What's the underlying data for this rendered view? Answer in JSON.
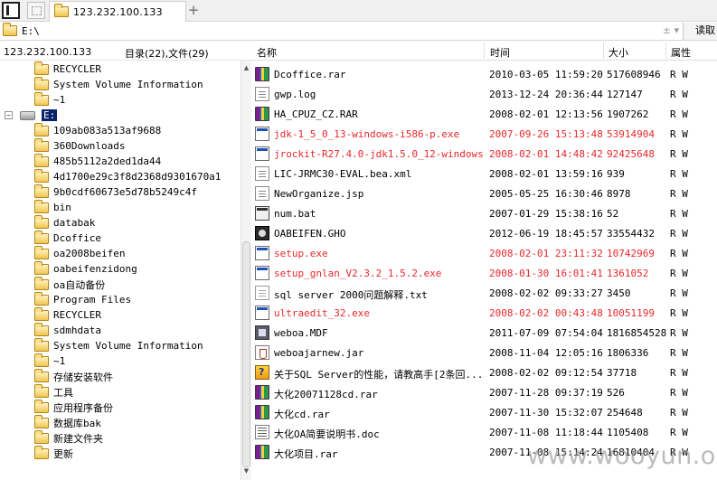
{
  "tab": {
    "title": "123.232.100.133",
    "add_label": "+"
  },
  "address": {
    "path": "E:\\",
    "controls": "± ▾",
    "go_label": "读取"
  },
  "left_panel": {
    "host": "123.232.100.133",
    "count": "目录(22),文件(29)"
  },
  "tree": {
    "items_before": [
      "RECYCLER",
      "System Volume Information",
      "~1"
    ],
    "drive": {
      "label": "E:",
      "expander": "−"
    },
    "items": [
      "109ab083a513af9688",
      "360Downloads",
      "485b5112a2ded1da44",
      "4d1700e29c3f8d2368d9301670a1",
      "9b0cdf60673e5d78b5249c4f",
      "bin",
      "databak",
      "Dcoffice",
      "oa2008beifen",
      "oabeifenzidong",
      "oa自动备份",
      "Program Files",
      "RECYCLER",
      "sdmhdata",
      "System Volume Information",
      "~1",
      "存储安装软件",
      "工具",
      "应用程序备份",
      "数据库bak",
      "新建文件夹",
      "更新"
    ]
  },
  "columns": {
    "name": "名称",
    "time": "时间",
    "size": "大小",
    "attr": "属性"
  },
  "files": [
    {
      "name": "Dcoffice.rar",
      "time": "2010-03-05 11:59:20",
      "size": "517608946",
      "attr": "R W",
      "icon": "rar-icon",
      "red": false
    },
    {
      "name": "gwp.log",
      "time": "2013-12-24 20:36:44",
      "size": "127147",
      "attr": "R W",
      "icon": "document-icon",
      "red": false
    },
    {
      "name": "HA_CPUZ_CZ.RAR",
      "time": "2008-02-01 12:13:56",
      "size": "1907262",
      "attr": "R W",
      "icon": "rar-icon",
      "red": false
    },
    {
      "name": "jdk-1_5_0_13-windows-i586-p.exe",
      "time": "2007-09-26 15:13:48",
      "size": "53914904",
      "attr": "R W",
      "icon": "exe-icon",
      "red": true
    },
    {
      "name": "jrockit-R27.4.0-jdk1.5.0_12-windows-...",
      "time": "2008-02-01 14:48:42",
      "size": "92425648",
      "attr": "R W",
      "icon": "exe-icon",
      "red": true
    },
    {
      "name": "LIC-JRMC30-EVAL.bea.xml",
      "time": "2008-02-01 13:59:16",
      "size": "939",
      "attr": "R W",
      "icon": "document-icon",
      "red": false
    },
    {
      "name": "NewOrganize.jsp",
      "time": "2005-05-25 16:30:46",
      "size": "8978",
      "attr": "R W",
      "icon": "document-icon",
      "red": false
    },
    {
      "name": "num.bat",
      "time": "2007-01-29 15:38:16",
      "size": "52",
      "attr": "R W",
      "icon": "bat-icon",
      "red": false
    },
    {
      "name": "OABEIFEN.GHO",
      "time": "2012-06-19 18:45:57",
      "size": "33554432",
      "attr": "R W",
      "icon": "gho-icon",
      "red": false
    },
    {
      "name": "setup.exe",
      "time": "2008-02-01 23:11:32",
      "size": "10742969",
      "attr": "R W",
      "icon": "exe-icon",
      "red": true
    },
    {
      "name": "setup_gnlan_V2.3.2_1.5.2.exe",
      "time": "2008-01-30 16:01:41",
      "size": "1361052",
      "attr": "R W",
      "icon": "exe-icon",
      "red": true
    },
    {
      "name": "sql server 2000问题解释.txt",
      "time": "2008-02-02 09:33:27",
      "size": "3450",
      "attr": "R W",
      "icon": "text-icon",
      "red": false
    },
    {
      "name": "ultraedit_32.exe",
      "time": "2008-02-02 00:43:48",
      "size": "10051199",
      "attr": "R W",
      "icon": "exe-icon",
      "red": true
    },
    {
      "name": "weboa.MDF",
      "time": "2011-07-09 07:54:04",
      "size": "1816854528",
      "attr": "R W",
      "icon": "database-icon",
      "red": false
    },
    {
      "name": "weboajarnew.jar",
      "time": "2008-11-04 12:05:16",
      "size": "1806336",
      "attr": "R W",
      "icon": "jar-icon",
      "red": false
    },
    {
      "name": "关于SQL Server的性能，请教高手[2条回...",
      "time": "2008-02-02 09:12:54",
      "size": "37718",
      "attr": "R W",
      "icon": "help-icon",
      "red": false
    },
    {
      "name": "大化20071128cd.rar",
      "time": "2007-11-28 09:37:19",
      "size": "526",
      "attr": "R W",
      "icon": "rar-icon",
      "red": false
    },
    {
      "name": "大化cd.rar",
      "time": "2007-11-30 15:32:07",
      "size": "254648",
      "attr": "R W",
      "icon": "rar-icon",
      "red": false
    },
    {
      "name": "大化OA简要说明书.doc",
      "time": "2007-11-08 11:18:44",
      "size": "1105408",
      "attr": "R W",
      "icon": "word-icon",
      "red": false
    },
    {
      "name": "大化项目.rar",
      "time": "2007-11-08 15:14:24",
      "size": "16810404",
      "attr": "R W",
      "icon": "rar-icon",
      "red": false
    }
  ],
  "watermark": "www.wooyun.org",
  "colors": {
    "red_text": "#e8282b",
    "selection": "#0a246a"
  }
}
